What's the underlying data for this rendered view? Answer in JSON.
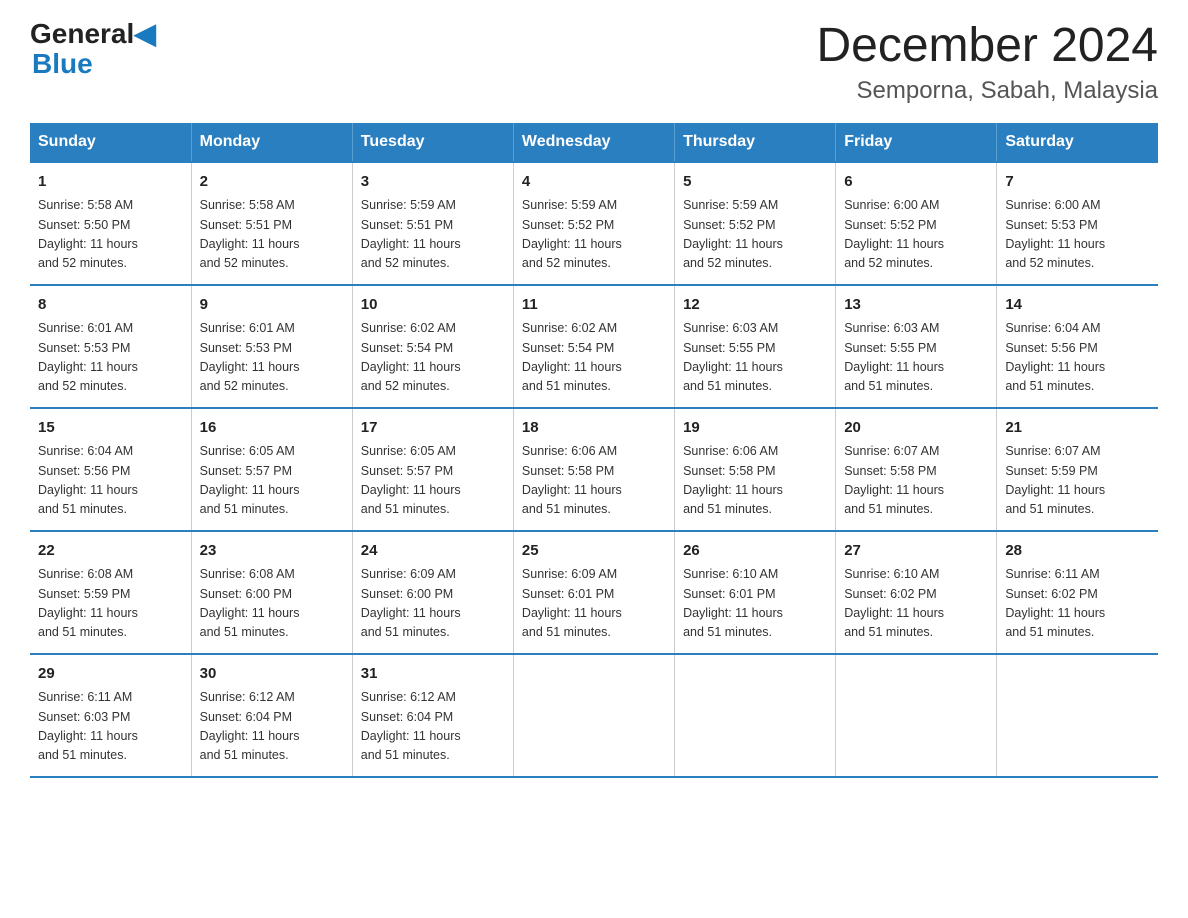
{
  "header": {
    "logo_general": "General",
    "logo_blue": "Blue",
    "title": "December 2024",
    "subtitle": "Semporna, Sabah, Malaysia"
  },
  "columns": [
    "Sunday",
    "Monday",
    "Tuesday",
    "Wednesday",
    "Thursday",
    "Friday",
    "Saturday"
  ],
  "weeks": [
    [
      {
        "day": "1",
        "info": "Sunrise: 5:58 AM\nSunset: 5:50 PM\nDaylight: 11 hours\nand 52 minutes."
      },
      {
        "day": "2",
        "info": "Sunrise: 5:58 AM\nSunset: 5:51 PM\nDaylight: 11 hours\nand 52 minutes."
      },
      {
        "day": "3",
        "info": "Sunrise: 5:59 AM\nSunset: 5:51 PM\nDaylight: 11 hours\nand 52 minutes."
      },
      {
        "day": "4",
        "info": "Sunrise: 5:59 AM\nSunset: 5:52 PM\nDaylight: 11 hours\nand 52 minutes."
      },
      {
        "day": "5",
        "info": "Sunrise: 5:59 AM\nSunset: 5:52 PM\nDaylight: 11 hours\nand 52 minutes."
      },
      {
        "day": "6",
        "info": "Sunrise: 6:00 AM\nSunset: 5:52 PM\nDaylight: 11 hours\nand 52 minutes."
      },
      {
        "day": "7",
        "info": "Sunrise: 6:00 AM\nSunset: 5:53 PM\nDaylight: 11 hours\nand 52 minutes."
      }
    ],
    [
      {
        "day": "8",
        "info": "Sunrise: 6:01 AM\nSunset: 5:53 PM\nDaylight: 11 hours\nand 52 minutes."
      },
      {
        "day": "9",
        "info": "Sunrise: 6:01 AM\nSunset: 5:53 PM\nDaylight: 11 hours\nand 52 minutes."
      },
      {
        "day": "10",
        "info": "Sunrise: 6:02 AM\nSunset: 5:54 PM\nDaylight: 11 hours\nand 52 minutes."
      },
      {
        "day": "11",
        "info": "Sunrise: 6:02 AM\nSunset: 5:54 PM\nDaylight: 11 hours\nand 51 minutes."
      },
      {
        "day": "12",
        "info": "Sunrise: 6:03 AM\nSunset: 5:55 PM\nDaylight: 11 hours\nand 51 minutes."
      },
      {
        "day": "13",
        "info": "Sunrise: 6:03 AM\nSunset: 5:55 PM\nDaylight: 11 hours\nand 51 minutes."
      },
      {
        "day": "14",
        "info": "Sunrise: 6:04 AM\nSunset: 5:56 PM\nDaylight: 11 hours\nand 51 minutes."
      }
    ],
    [
      {
        "day": "15",
        "info": "Sunrise: 6:04 AM\nSunset: 5:56 PM\nDaylight: 11 hours\nand 51 minutes."
      },
      {
        "day": "16",
        "info": "Sunrise: 6:05 AM\nSunset: 5:57 PM\nDaylight: 11 hours\nand 51 minutes."
      },
      {
        "day": "17",
        "info": "Sunrise: 6:05 AM\nSunset: 5:57 PM\nDaylight: 11 hours\nand 51 minutes."
      },
      {
        "day": "18",
        "info": "Sunrise: 6:06 AM\nSunset: 5:58 PM\nDaylight: 11 hours\nand 51 minutes."
      },
      {
        "day": "19",
        "info": "Sunrise: 6:06 AM\nSunset: 5:58 PM\nDaylight: 11 hours\nand 51 minutes."
      },
      {
        "day": "20",
        "info": "Sunrise: 6:07 AM\nSunset: 5:58 PM\nDaylight: 11 hours\nand 51 minutes."
      },
      {
        "day": "21",
        "info": "Sunrise: 6:07 AM\nSunset: 5:59 PM\nDaylight: 11 hours\nand 51 minutes."
      }
    ],
    [
      {
        "day": "22",
        "info": "Sunrise: 6:08 AM\nSunset: 5:59 PM\nDaylight: 11 hours\nand 51 minutes."
      },
      {
        "day": "23",
        "info": "Sunrise: 6:08 AM\nSunset: 6:00 PM\nDaylight: 11 hours\nand 51 minutes."
      },
      {
        "day": "24",
        "info": "Sunrise: 6:09 AM\nSunset: 6:00 PM\nDaylight: 11 hours\nand 51 minutes."
      },
      {
        "day": "25",
        "info": "Sunrise: 6:09 AM\nSunset: 6:01 PM\nDaylight: 11 hours\nand 51 minutes."
      },
      {
        "day": "26",
        "info": "Sunrise: 6:10 AM\nSunset: 6:01 PM\nDaylight: 11 hours\nand 51 minutes."
      },
      {
        "day": "27",
        "info": "Sunrise: 6:10 AM\nSunset: 6:02 PM\nDaylight: 11 hours\nand 51 minutes."
      },
      {
        "day": "28",
        "info": "Sunrise: 6:11 AM\nSunset: 6:02 PM\nDaylight: 11 hours\nand 51 minutes."
      }
    ],
    [
      {
        "day": "29",
        "info": "Sunrise: 6:11 AM\nSunset: 6:03 PM\nDaylight: 11 hours\nand 51 minutes."
      },
      {
        "day": "30",
        "info": "Sunrise: 6:12 AM\nSunset: 6:04 PM\nDaylight: 11 hours\nand 51 minutes."
      },
      {
        "day": "31",
        "info": "Sunrise: 6:12 AM\nSunset: 6:04 PM\nDaylight: 11 hours\nand 51 minutes."
      },
      {
        "day": "",
        "info": ""
      },
      {
        "day": "",
        "info": ""
      },
      {
        "day": "",
        "info": ""
      },
      {
        "day": "",
        "info": ""
      }
    ]
  ]
}
